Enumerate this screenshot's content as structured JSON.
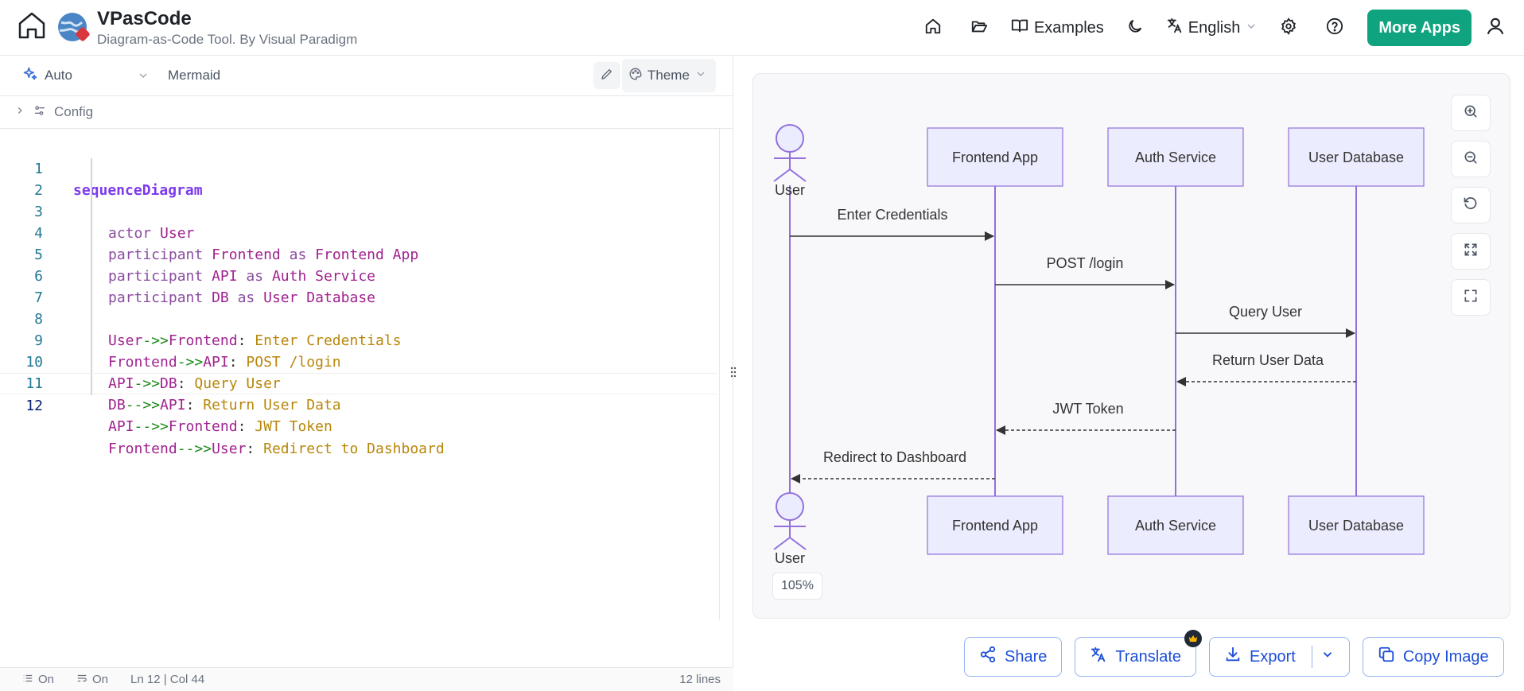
{
  "header": {
    "title": "VPasCode",
    "subtitle": "Diagram-as-Code Tool. By Visual Paradigm",
    "nav": {
      "examples_label": "Examples",
      "language_label": "English",
      "more_apps_label": "More Apps"
    }
  },
  "editor": {
    "mode_label": "Auto",
    "language_label": "Mermaid",
    "theme_label": "Theme",
    "config_label": "Config",
    "lines": [
      {
        "n": "1"
      },
      {
        "n": "2"
      },
      {
        "n": "3"
      },
      {
        "n": "4"
      },
      {
        "n": "5"
      },
      {
        "n": "6"
      },
      {
        "n": "7"
      },
      {
        "n": "8"
      },
      {
        "n": "9"
      },
      {
        "n": "10"
      },
      {
        "n": "11"
      },
      {
        "n": "12"
      }
    ],
    "code": {
      "l1": "sequenceDiagram",
      "kw_actor": "actor",
      "kw_participant": "participant",
      "kw_as": "as",
      "user": "User",
      "frontend": "Frontend",
      "frontend_alias": "Frontend App",
      "api": "API",
      "api_alias": "Auth Service",
      "db": "DB",
      "db_alias": "User Database",
      "arrow_solid": "->>",
      "arrow_dashed": "-->>",
      "colon": ":",
      "msg_credentials": "Enter Credentials",
      "msg_login": "POST /login",
      "msg_query": "Query User",
      "msg_return": "Return User Data",
      "msg_jwt": "JWT Token",
      "msg_redirect": "Redirect to Dashboard"
    },
    "status": {
      "wrap": "On",
      "format": "On",
      "position": "Ln 12 | Col 44",
      "line_count": "12 lines"
    }
  },
  "preview": {
    "zoom_level": "105%",
    "diagram": {
      "actor_user": "User",
      "participant_frontend": "Frontend App",
      "participant_api": "Auth Service",
      "participant_db": "User Database",
      "messages": [
        "Enter Credentials",
        "POST /login",
        "Query User",
        "Return User Data",
        "JWT Token",
        "Redirect to Dashboard"
      ]
    }
  },
  "actions": {
    "share_label": "Share",
    "translate_label": "Translate",
    "export_label": "Export",
    "copy_label": "Copy Image"
  },
  "colors": {
    "accent_green": "#10a37f",
    "action_blue": "#1d4ed8",
    "lifeline_purple": "#9370db",
    "actor_fill": "#ececff"
  }
}
